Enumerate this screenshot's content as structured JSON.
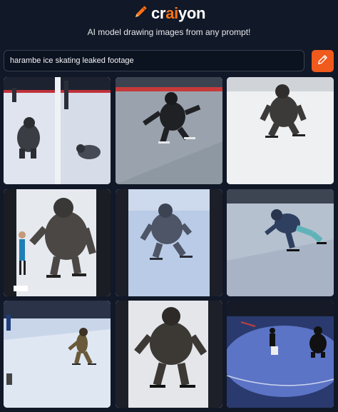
{
  "brand": {
    "name_prefix": "cr",
    "name_accent": "ai",
    "name_suffix": "yon",
    "tagline": "AI model drawing images from any prompt!",
    "accent_color": "#f97316"
  },
  "prompt": {
    "value": "harambe ice skating leaked footage"
  },
  "draw_button": {
    "icon": "pencil-icon",
    "color": "#f05a1c"
  },
  "results": {
    "images": [
      {
        "subject": "gorilla crouching on ice rink"
      },
      {
        "subject": "gorilla skating on gray ice"
      },
      {
        "subject": "gorilla skating on white ice"
      },
      {
        "subject": "gorilla standing beside skater"
      },
      {
        "subject": "gorilla skating blue tinted"
      },
      {
        "subject": "gorilla skater leaning forward"
      },
      {
        "subject": "skater on bright ice"
      },
      {
        "subject": "gorilla on skates close-up"
      },
      {
        "subject": "skaters on dark rink"
      }
    ]
  }
}
